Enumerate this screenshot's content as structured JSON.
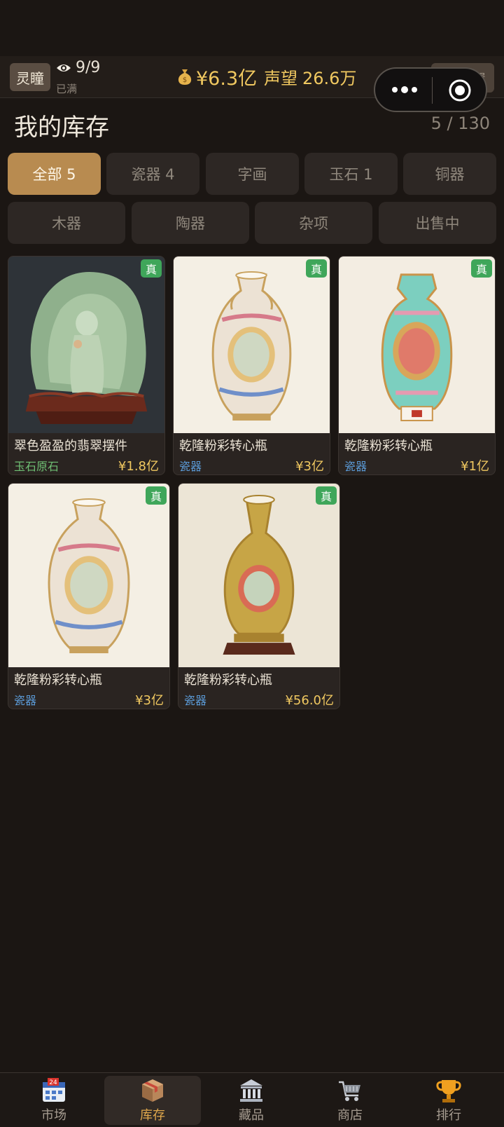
{
  "topbar": {
    "eye_button": "灵瞳",
    "eye_count": "9/9",
    "eye_status": "已满",
    "money": "¥6.3亿",
    "reputation_label": "声望",
    "reputation_value": "26.6万",
    "settings_label": "设置"
  },
  "page": {
    "title": "我的库存",
    "count": "5 / 130"
  },
  "filters": {
    "all": "全部 5",
    "porcelain": "瓷器 4",
    "calligraphy": "字画",
    "jade": "玉石 1",
    "bronze": "铜器",
    "wood": "木器",
    "pottery": "陶器",
    "misc": "杂项",
    "on_sale": "出售中"
  },
  "colors": {
    "accent": "#b88b50",
    "price": "#f0c860",
    "badge": "#3fa65a",
    "cat_jade": "#6fbf74",
    "cat_porcelain": "#5b9ad6"
  },
  "items": [
    {
      "name": "翠色盈盈的翡翠摆件",
      "category": "玉石原石",
      "price": "¥1.8亿",
      "badge": "真"
    },
    {
      "name": "乾隆粉彩转心瓶",
      "category": "瓷器",
      "price": "¥3亿",
      "badge": "真"
    },
    {
      "name": "乾隆粉彩转心瓶",
      "category": "瓷器",
      "price": "¥1亿",
      "badge": "真"
    },
    {
      "name": "乾隆粉彩转心瓶",
      "category": "瓷器",
      "price": "¥3亿",
      "badge": "真"
    },
    {
      "name": "乾隆粉彩转心瓶",
      "category": "瓷器",
      "price": "¥56.0亿",
      "badge": "真"
    }
  ],
  "nav": {
    "market": "市场",
    "inventory": "库存",
    "collection": "藏品",
    "shop": "商店",
    "ranking": "排行",
    "calendar_day": "24"
  }
}
